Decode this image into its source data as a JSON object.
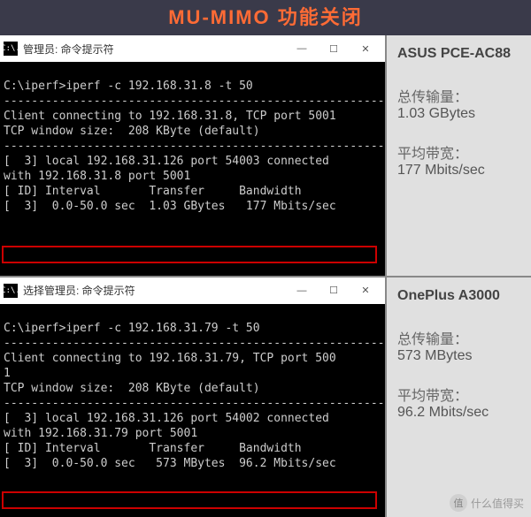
{
  "chart_data": {
    "type": "table",
    "title": "MU-MIMO 功能关闭 — iperf results",
    "rows": [
      {
        "device": "ASUS PCE-AC88",
        "server_ip": "192.168.31.8",
        "client_ip": "192.168.31.126",
        "local_port": 54003,
        "remote_port": 5001,
        "interval_sec": "0.0-50.0",
        "transfer": "1.03 GBytes",
        "bandwidth": "177 Mbits/sec",
        "tcp_window": "208 KByte"
      },
      {
        "device": "OnePlus A3000",
        "server_ip": "192.168.31.79",
        "client_ip": "192.168.31.126",
        "local_port": 54002,
        "remote_port": 5001,
        "interval_sec": "0.0-50.0",
        "transfer": "573 MBytes",
        "bandwidth": "96.2 Mbits/sec",
        "tcp_window": "208 KByte"
      }
    ]
  },
  "header": {
    "title": "MU-MIMO 功能关闭"
  },
  "cmd_icon": "C:\\.",
  "win_btns": {
    "min": "—",
    "max": "☐",
    "close": "✕"
  },
  "tests": [
    {
      "title": "管理员: 命令提示符",
      "lines": [
        "C:\\iperf>iperf -c 192.168.31.8 -t 50",
        "------------------------------------------------------------",
        "Client connecting to 192.168.31.8, TCP port 5001",
        "TCP window size:  208 KByte (default)",
        "------------------------------------------------------------",
        "[  3] local 192.168.31.126 port 54003 connected",
        "with 192.168.31.8 port 5001",
        "[ ID] Interval       Transfer     Bandwidth",
        "[  3]  0.0-50.0 sec  1.03 GBytes   177 Mbits/sec"
      ],
      "summary": {
        "device": "ASUS PCE-AC88",
        "transfer_label": "总传输量：",
        "transfer_val": "1.03 GBytes",
        "bw_label": "平均带宽：",
        "bw_val": "177 Mbits/sec"
      }
    },
    {
      "title": "选择管理员: 命令提示符",
      "lines": [
        "C:\\iperf>iperf -c 192.168.31.79 -t 50",
        "------------------------------------------------------------",
        "Client connecting to 192.168.31.79, TCP port 500",
        "1",
        "TCP window size:  208 KByte (default)",
        "------------------------------------------------------------",
        "[  3] local 192.168.31.126 port 54002 connected ",
        "with 192.168.31.79 port 5001",
        "[ ID] Interval       Transfer     Bandwidth",
        "[  3]  0.0-50.0 sec   573 MBytes  96.2 Mbits/sec"
      ],
      "summary": {
        "device": "OnePlus A3000",
        "transfer_label": "总传输量：",
        "transfer_val": "573 MBytes",
        "bw_label": "平均带宽：",
        "bw_val": "96.2 Mbits/sec"
      }
    }
  ],
  "watermark": {
    "logo": "值",
    "text": "什么值得买"
  }
}
